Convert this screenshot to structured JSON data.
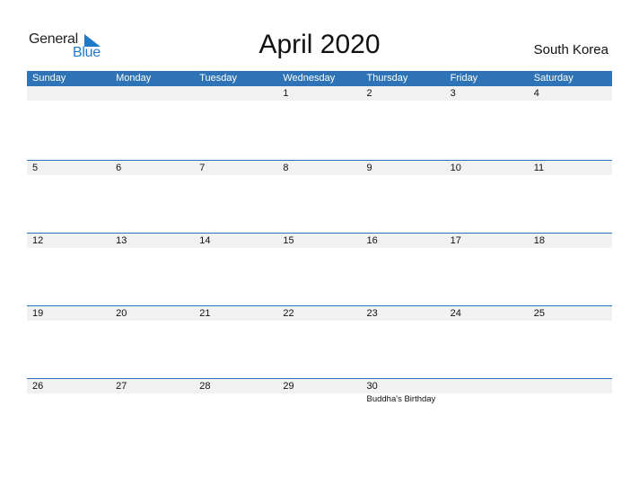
{
  "logo": {
    "line1": "General",
    "line2": "Blue",
    "accent": "#1f7ac9"
  },
  "title": "April 2020",
  "country": "South Korea",
  "colors": {
    "header_bg": "#2e73b5",
    "band_bg": "#f1f1f1"
  },
  "weekdays": [
    "Sunday",
    "Monday",
    "Tuesday",
    "Wednesday",
    "Thursday",
    "Friday",
    "Saturday"
  ],
  "weeks": [
    {
      "days": [
        {
          "num": ""
        },
        {
          "num": ""
        },
        {
          "num": ""
        },
        {
          "num": "1"
        },
        {
          "num": "2"
        },
        {
          "num": "3"
        },
        {
          "num": "4"
        }
      ]
    },
    {
      "days": [
        {
          "num": "5"
        },
        {
          "num": "6"
        },
        {
          "num": "7"
        },
        {
          "num": "8"
        },
        {
          "num": "9"
        },
        {
          "num": "10"
        },
        {
          "num": "11"
        }
      ]
    },
    {
      "days": [
        {
          "num": "12"
        },
        {
          "num": "13"
        },
        {
          "num": "14"
        },
        {
          "num": "15"
        },
        {
          "num": "16"
        },
        {
          "num": "17"
        },
        {
          "num": "18"
        }
      ]
    },
    {
      "days": [
        {
          "num": "19"
        },
        {
          "num": "20"
        },
        {
          "num": "21"
        },
        {
          "num": "22"
        },
        {
          "num": "23"
        },
        {
          "num": "24"
        },
        {
          "num": "25"
        }
      ]
    },
    {
      "days": [
        {
          "num": "26"
        },
        {
          "num": "27"
        },
        {
          "num": "28"
        },
        {
          "num": "29"
        },
        {
          "num": "30",
          "event": "Buddha's Birthday"
        },
        {
          "num": ""
        },
        {
          "num": ""
        }
      ]
    }
  ]
}
